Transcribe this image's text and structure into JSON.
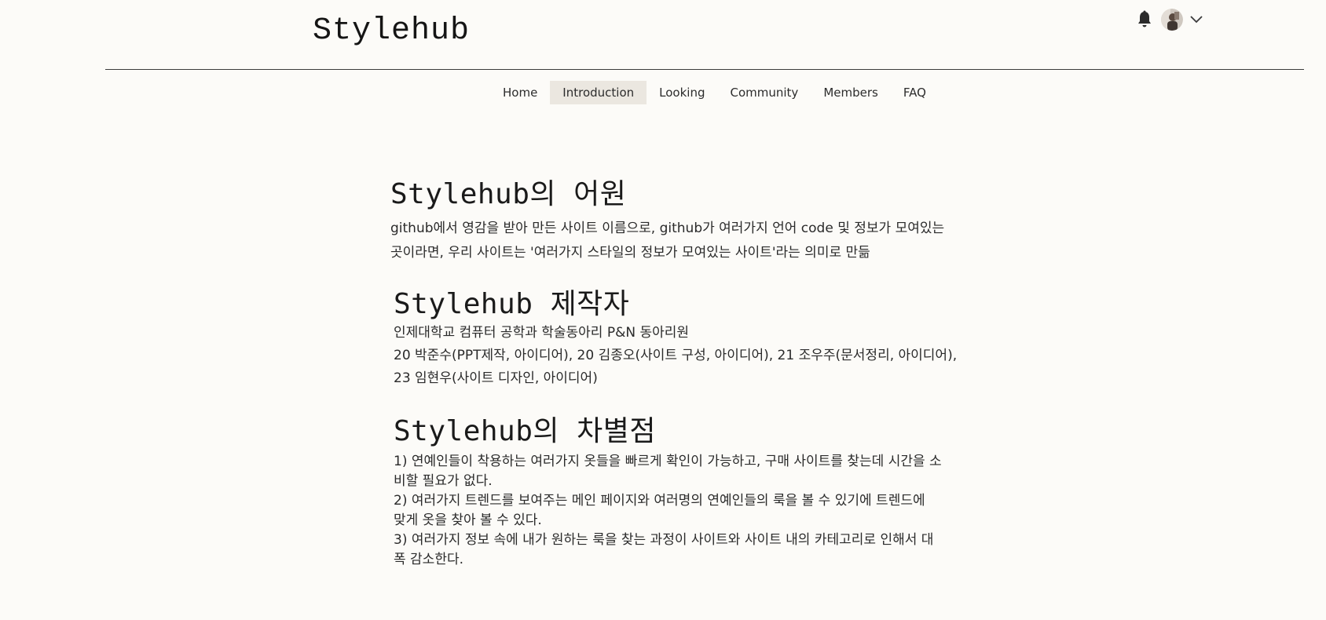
{
  "header": {
    "site_title": "Stylehub",
    "notification_icon": "bell-icon",
    "avatar_icon": "user-avatar",
    "menu_icon": "chevron-down-icon"
  },
  "nav": {
    "items": [
      {
        "label": "Home",
        "active": false
      },
      {
        "label": "Introduction",
        "active": true
      },
      {
        "label": "Looking",
        "active": false
      },
      {
        "label": "Community",
        "active": false
      },
      {
        "label": "Members",
        "active": false
      },
      {
        "label": "FAQ",
        "active": false
      }
    ]
  },
  "sections": {
    "origin": {
      "heading": "Stylehub의 어원",
      "lines": [
        "github에서 영감을 받아 만든 사이트 이름으로, github가 여러가지 언어 code 및 정보가 모여있는",
        "곳이라면, 우리 사이트는 '여러가지 스타일의 정보가 모여있는 사이트'라는 의미로 만듦"
      ]
    },
    "makers": {
      "heading": "Stylehub 제작자",
      "lines": [
        "인제대학교 컴퓨터 공학과 학술동아리 P&N 동아리원",
        "20 박준수(PPT제작, 아이디어), 20 김종오(사이트 구성, 아이디어), 21 조우주(문서정리, 아이디어),",
        "23 임현우(사이트 디자인, 아이디어)"
      ]
    },
    "difference": {
      "heading": "Stylehub의 차별점",
      "lines": [
        "1) 연예인들이 착용하는 여러가지 옷들을 빠르게 확인이 가능하고, 구매 사이트를 찾는데 시간을 소",
        "비할 필요가 없다.",
        "2) 여러가지 트렌드를 보여주는 메인 페이지와 여러명의 연예인들의 룩을 볼 수 있기에 트렌드에",
        "맞게 옷을 찾아 볼 수 있다.",
        "3) 여러가지 정보 속에 내가 원하는 룩을 찾는 과정이 사이트와 사이트 내의 카테고리로 인해서 대",
        "폭 감소한다."
      ]
    }
  },
  "colors": {
    "background": "#fcfbf8",
    "nav_active_bg": "#ebe7e0",
    "text": "#1f1f1f"
  }
}
